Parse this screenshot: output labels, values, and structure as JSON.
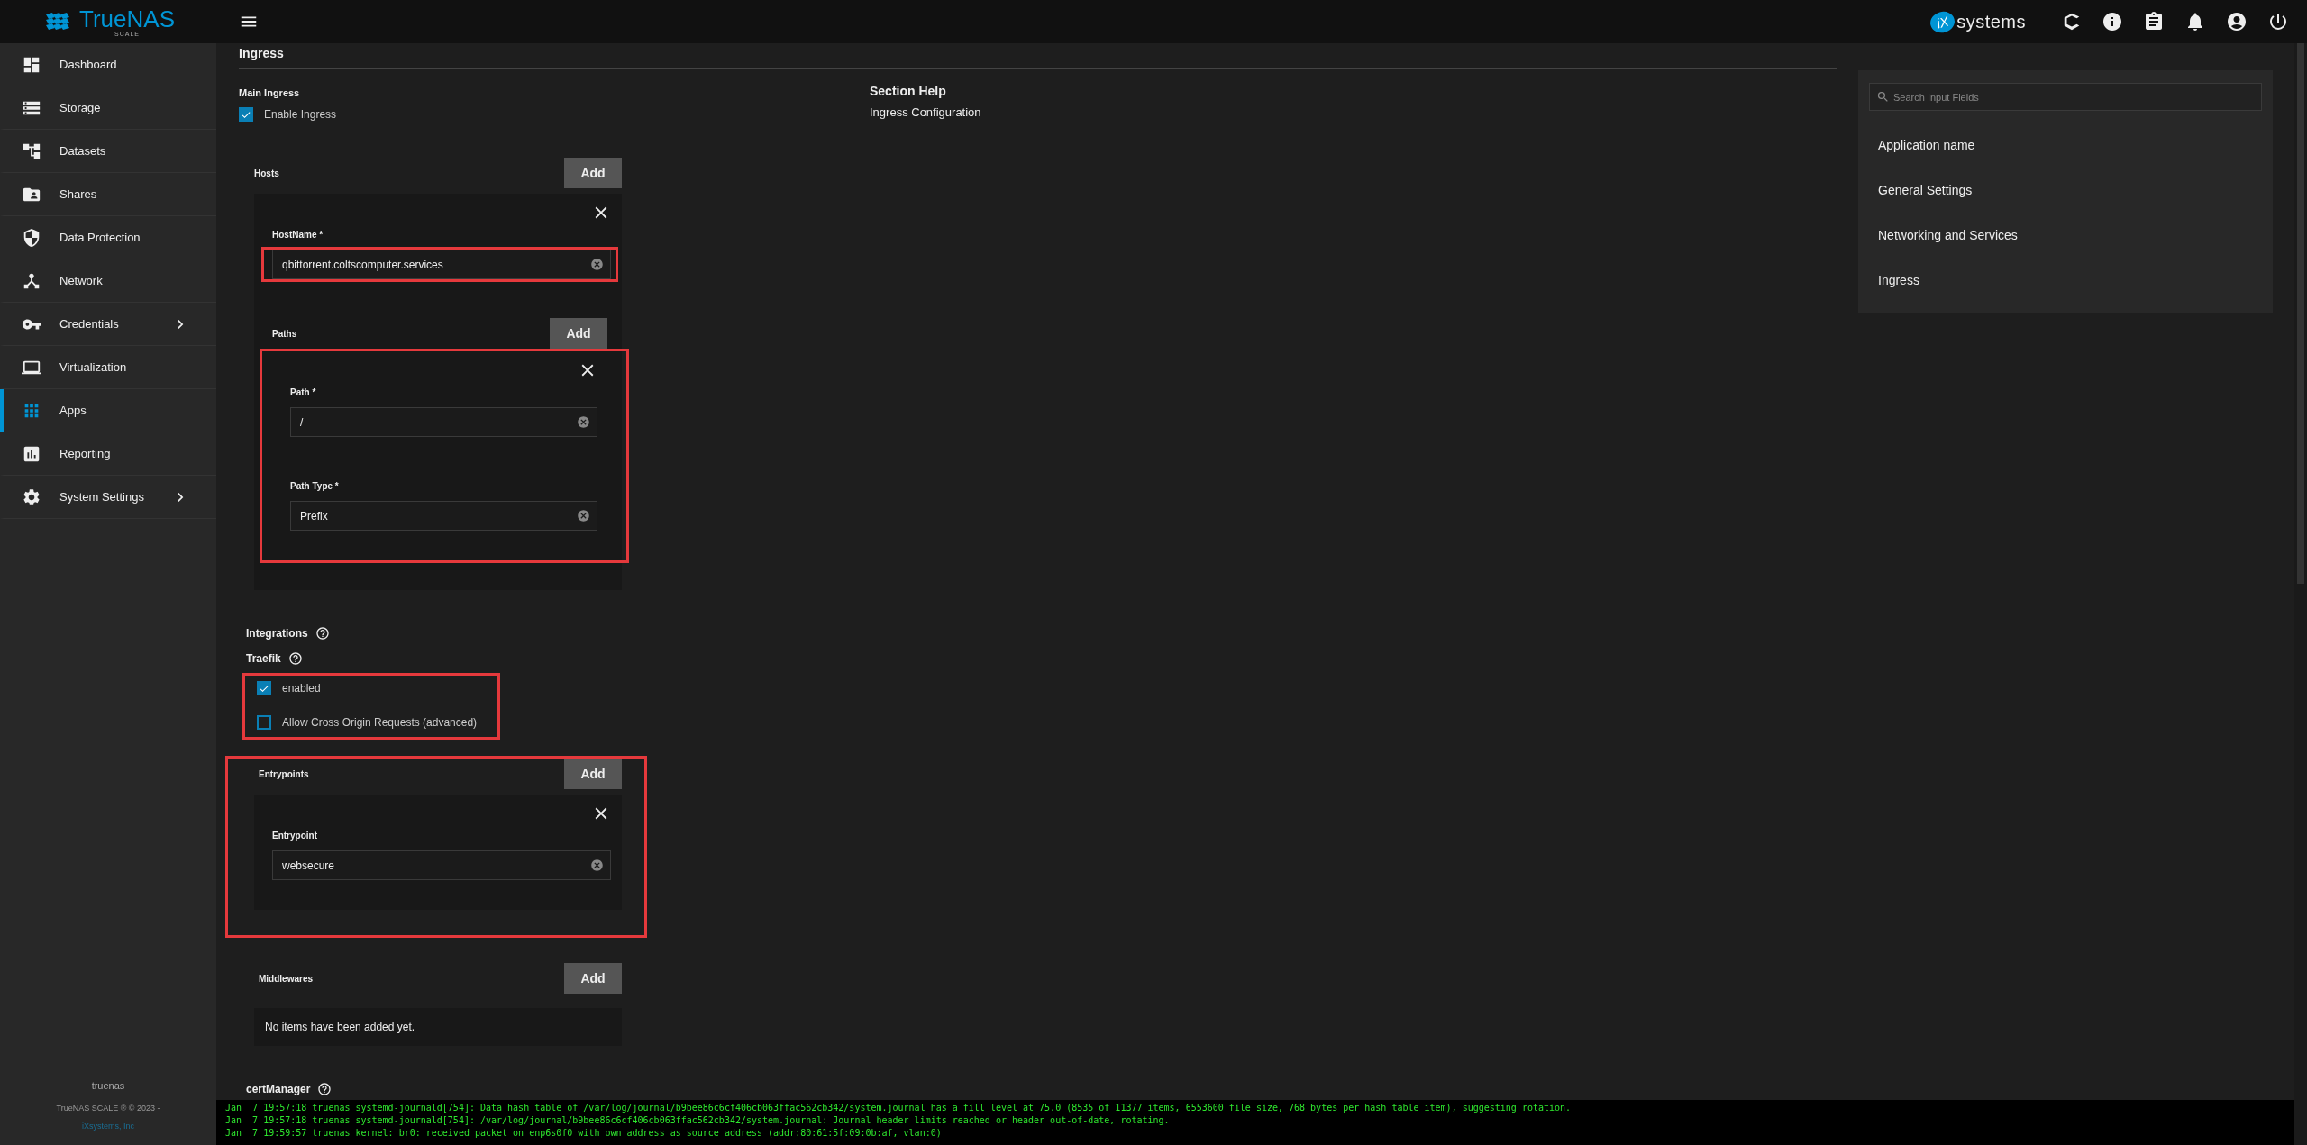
{
  "brand": {
    "logo_text": "TrueNAS",
    "logo_subtext": "SCALE"
  },
  "sidebar": {
    "items": [
      {
        "label": "Dashboard",
        "selected": false,
        "expandable": false
      },
      {
        "label": "Storage",
        "selected": false,
        "expandable": false
      },
      {
        "label": "Datasets",
        "selected": false,
        "expandable": false
      },
      {
        "label": "Shares",
        "selected": false,
        "expandable": false
      },
      {
        "label": "Data Protection",
        "selected": false,
        "expandable": false
      },
      {
        "label": "Network",
        "selected": false,
        "expandable": false
      },
      {
        "label": "Credentials",
        "selected": false,
        "expandable": true
      },
      {
        "label": "Virtualization",
        "selected": false,
        "expandable": false
      },
      {
        "label": "Apps",
        "selected": true,
        "expandable": false
      },
      {
        "label": "Reporting",
        "selected": false,
        "expandable": false
      },
      {
        "label": "System Settings",
        "selected": false,
        "expandable": true
      }
    ],
    "hostname": "truenas",
    "copyright": "TrueNAS SCALE ® © 2023 -",
    "company_link": "iXsystems, Inc"
  },
  "header": {
    "vendor_logo": {
      "mark": "iX",
      "text": "systems"
    }
  },
  "section": {
    "title": "Ingress",
    "group_title": "Main Ingress",
    "enable": {
      "label": "Enable Ingress",
      "checked": true
    },
    "hosts": {
      "label": "Hosts",
      "add_button": "Add",
      "items": [
        {
          "fields": [
            {
              "label": "HostName *",
              "value": "qbittorrent.coltscomputer.services",
              "highlighted": true
            }
          ],
          "paths": {
            "label": "Paths",
            "add_button": "Add",
            "highlighted": true,
            "items": [
              {
                "fields": [
                  {
                    "label": "Path *",
                    "value": "/",
                    "highlighted": false
                  },
                  {
                    "label": "Path Type *",
                    "value": "Prefix",
                    "highlighted": false
                  }
                ]
              }
            ]
          }
        }
      ]
    },
    "integrations": {
      "title": "Integrations",
      "traefik": {
        "title": "Traefik",
        "highlighted": true,
        "options": [
          {
            "label": "enabled",
            "checked": true
          },
          {
            "label": "Allow Cross Origin Requests (advanced)",
            "checked": false
          }
        ]
      },
      "entrypoints": {
        "label": "Entrypoints",
        "add_button": "Add",
        "highlighted": true,
        "items": [
          {
            "fields": [
              {
                "label": "Entrypoint",
                "value": "websecure",
                "highlighted": false
              }
            ]
          }
        ]
      },
      "middlewares": {
        "label": "Middlewares",
        "add_button": "Add",
        "empty_text": "No items have been added yet."
      },
      "cert_manager": {
        "title": "certManager"
      }
    }
  },
  "help": {
    "title": "Section Help",
    "text": "Ingress Configuration"
  },
  "search": {
    "placeholder": "Search Input Fields"
  },
  "nav_sections": [
    {
      "label": "Application name"
    },
    {
      "label": "General Settings"
    },
    {
      "label": "Networking and Services"
    },
    {
      "label": "Ingress"
    }
  ],
  "console": {
    "lines": [
      "Jan  7 19:57:18 truenas systemd-journald[754]: Data hash table of /var/log/journal/b9bee86c6cf406cb063ffac562cb342/system.journal has a fill level at 75.0 (8535 of 11377 items, 6553600 file size, 768 bytes per hash table item), suggesting rotation.",
      "Jan  7 19:57:18 truenas systemd-journald[754]: /var/log/journal/b9bee86c6cf406cb063ffac562cb342/system.journal: Journal header limits reached or header out-of-date, rotating.",
      "Jan  7 19:59:57 truenas kernel: br0: received packet on enp6s0f0 with own address as source address (addr:80:61:5f:09:0b:af, vlan:0)"
    ]
  }
}
